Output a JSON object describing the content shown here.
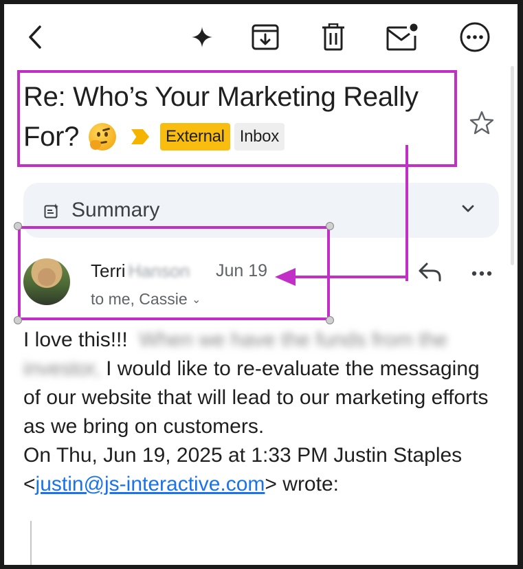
{
  "toolbar": {
    "back_icon": "chevron-left-icon",
    "actions": [
      "sparkle-icon",
      "archive-icon",
      "trash-icon",
      "mark-unread-icon",
      "more-options-icon"
    ]
  },
  "email": {
    "subject_line1": "Re: Who’s Your Marketing Really",
    "subject_line2": "For?",
    "subject_emoji": "thinking-face-emoji",
    "labels": [
      "External",
      "Inbox"
    ],
    "summary_label": "Summary",
    "sender_first_name": "Terri",
    "sender_last_name_redacted": "Hanson",
    "date": "Jun 19",
    "recipients": "to me, Cassie",
    "body_start": "I love this!!!",
    "body_redacted": "When we have the funds from the investor,",
    "body_rest": "I would like to re-evaluate the messaging of our website that will lead to our marketing efforts as we bring on customers.",
    "quote_prefix": "On Thu, Jun 19, 2025 at 1:33 PM Justin Staples <",
    "quote_email": "justin@js-interactive.com",
    "quote_suffix": "> wrote:"
  },
  "colors": {
    "annotation": "#c22fc6",
    "external_tag": "#f8bd0f",
    "inbox_tag": "#eeeeee",
    "summary_bg": "#f0f4f9",
    "link": "#1a73e8"
  }
}
